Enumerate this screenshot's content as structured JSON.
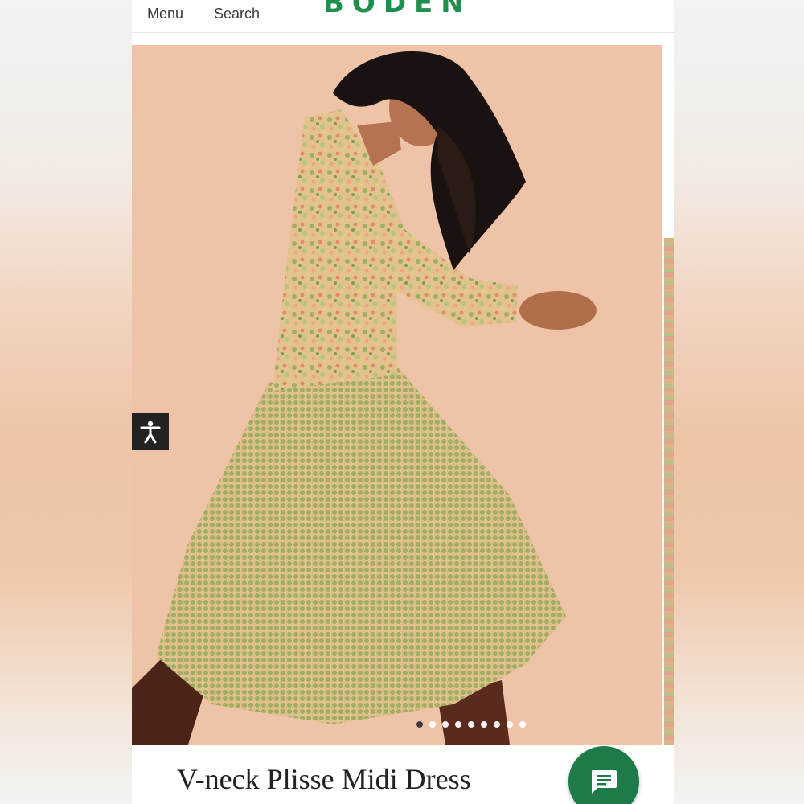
{
  "header": {
    "menu_label": "Menu",
    "search_label": "Search",
    "logo_text": "BODEN"
  },
  "carousel": {
    "slide_count": 9,
    "active_index": 0
  },
  "product": {
    "title": "V-neck Plisse Midi Dress"
  },
  "colors": {
    "brand": "#1f8f4e",
    "chat": "#1f7a4a",
    "background": "#efc0a6"
  },
  "icons": {
    "accessibility": "accessibility-icon",
    "chat": "chat-icon"
  }
}
